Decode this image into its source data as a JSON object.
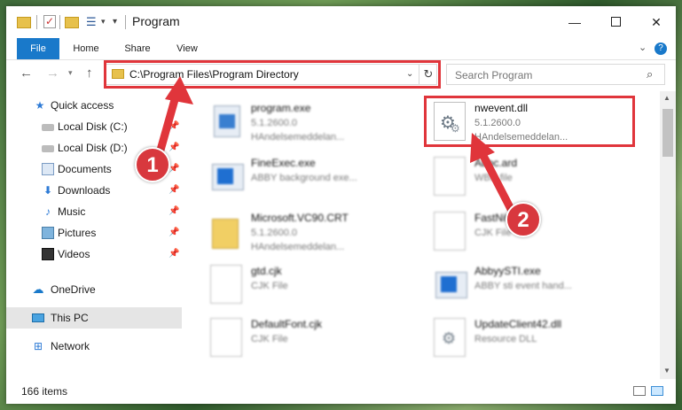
{
  "window": {
    "title": "Program"
  },
  "ribbon": {
    "tabs": {
      "file": "File",
      "home": "Home",
      "share": "Share",
      "view": "View"
    },
    "help": "?"
  },
  "address": {
    "path": "C:\\Program Files\\Program Directory"
  },
  "search": {
    "placeholder": "Search Program"
  },
  "sidebar": {
    "items": [
      {
        "label": "Quick access"
      },
      {
        "label": "Local Disk (C:)"
      },
      {
        "label": "Local Disk (D:)"
      },
      {
        "label": "Documents"
      },
      {
        "label": "Downloads"
      },
      {
        "label": "Music"
      },
      {
        "label": "Pictures"
      },
      {
        "label": "Videos"
      },
      {
        "label": "OneDrive"
      },
      {
        "label": "This PC"
      },
      {
        "label": "Network"
      }
    ]
  },
  "files": [
    {
      "name": "program.exe",
      "line1": "5.1.2600.0",
      "line2": "HAndelsemeddelan..."
    },
    {
      "name": "nwevent.dll",
      "line1": "5.1.2600.0",
      "line2": "HAndelsemeddelan..."
    },
    {
      "name": "FineExec.exe",
      "line1": "ABBY background exe..."
    },
    {
      "name": "Abbc.ard",
      "line1": "WBD file"
    },
    {
      "name": "Microsoft.VC90.CRT",
      "line1": "5.1.2600.0",
      "line2": "HAndelsemeddelan..."
    },
    {
      "name": "FastNit",
      "line1": "CJK File"
    },
    {
      "name": "gtd.cjk",
      "line1": "CJK File"
    },
    {
      "name": "AbbyySTI.exe",
      "line1": "ABBY sti event hand..."
    },
    {
      "name": "DefaultFont.cjk",
      "line1": "CJK File"
    },
    {
      "name": "UpdateClient42.dll",
      "line1": "Resource DLL"
    }
  ],
  "status": {
    "items": "166 items"
  },
  "annotations": {
    "step1": "1",
    "step2": "2",
    "color": "#e0353b"
  }
}
